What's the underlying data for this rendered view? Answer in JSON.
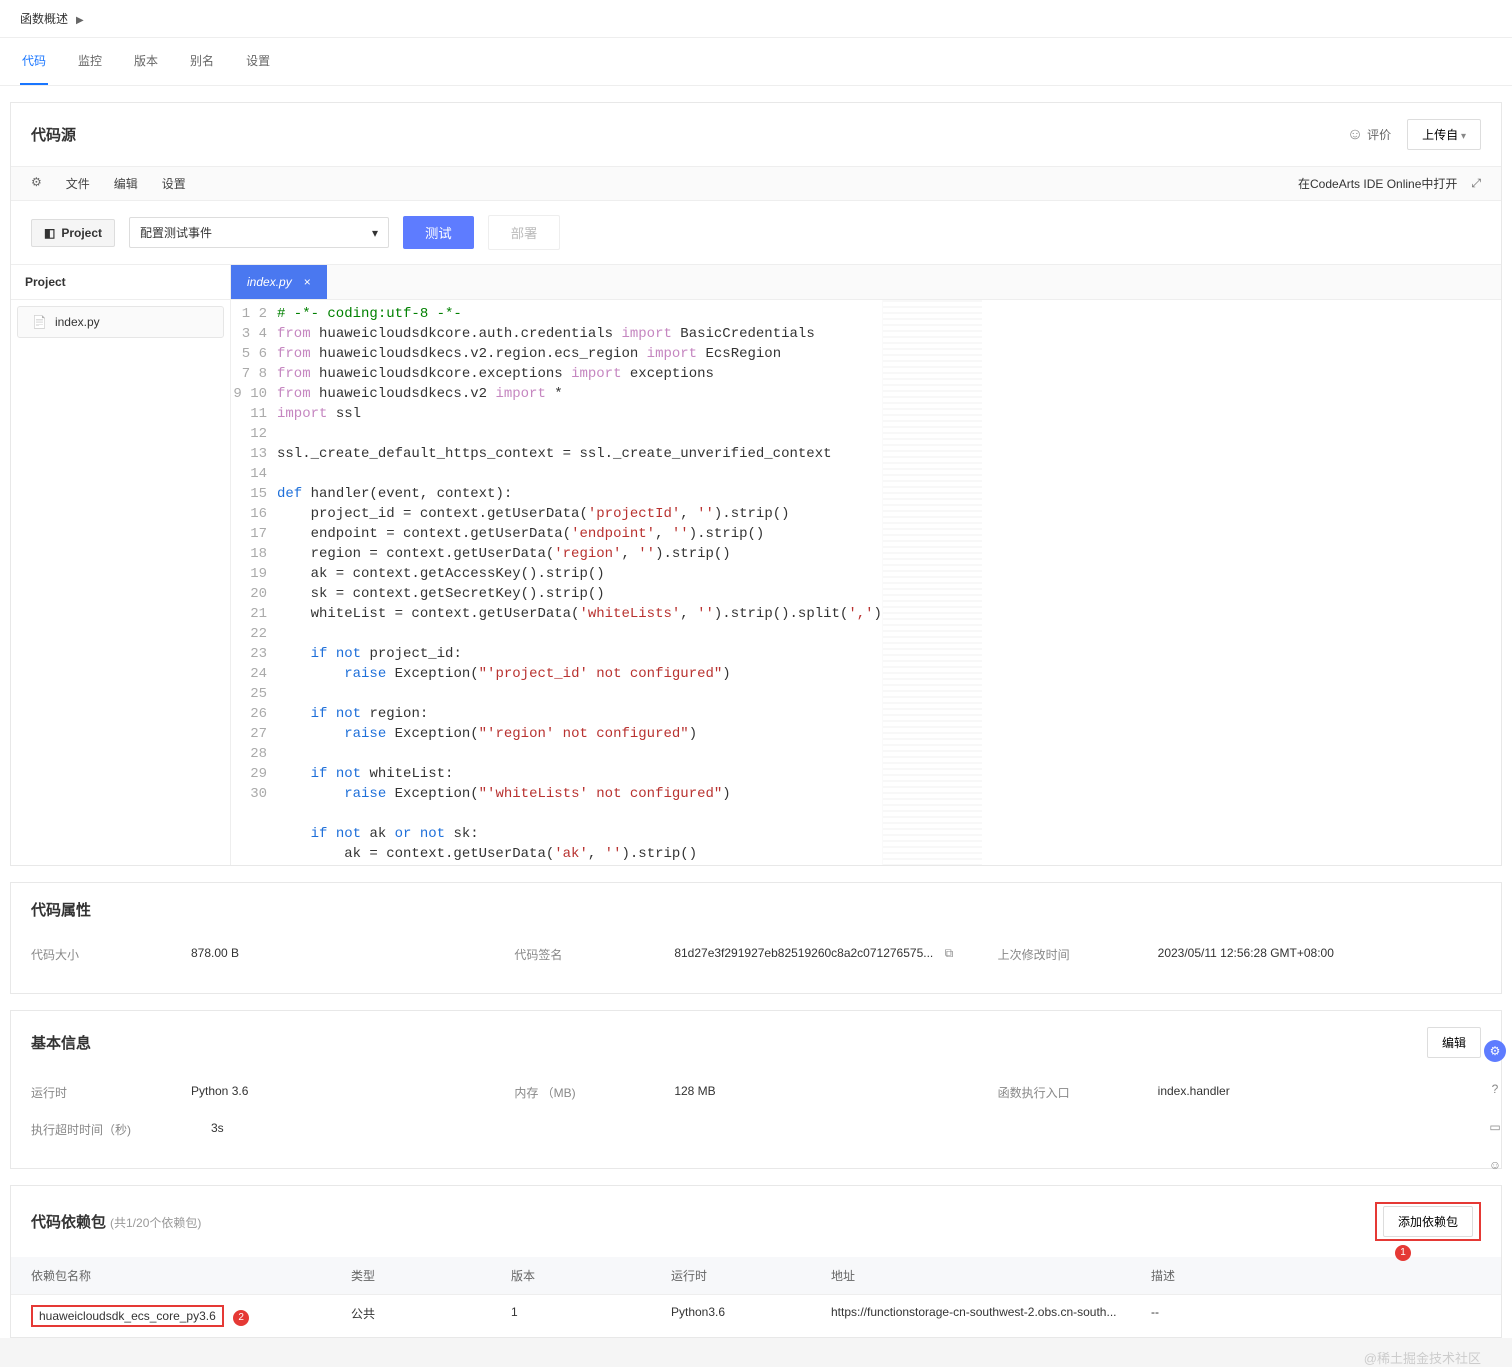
{
  "header": {
    "overview": "函数概述"
  },
  "tabs": {
    "code": "代码",
    "monitor": "监控",
    "version": "版本",
    "alias": "别名",
    "settings": "设置"
  },
  "code_source": {
    "title": "代码源",
    "feedback": "评价",
    "upload_from": "上传自",
    "open_in_ide": "在CodeArts IDE Online中打开",
    "menu_file": "文件",
    "menu_edit": "编辑",
    "menu_settings": "设置",
    "project_btn": "Project",
    "test_event_placeholder": "配置测试事件",
    "test_btn": "测试",
    "deploy_btn": "部署",
    "sidebar_title": "Project",
    "file_name": "index.py",
    "tab_file": "index.py"
  },
  "code_attr": {
    "title": "代码属性",
    "size_label": "代码大小",
    "size_val": "878.00 B",
    "sign_label": "代码签名",
    "sign_val": "81d27e3f291927eb82519260c8a2c071276575...",
    "modified_label": "上次修改时间",
    "modified_val": "2023/05/11 12:56:28 GMT+08:00"
  },
  "basic_info": {
    "title": "基本信息",
    "edit": "编辑",
    "runtime_label": "运行时",
    "runtime_val": "Python 3.6",
    "memory_label": "内存 （MB)",
    "memory_val": "128 MB",
    "entry_label": "函数执行入口",
    "entry_val": "index.handler",
    "timeout_label": "执行超时时间（秒)",
    "timeout_val": "3s"
  },
  "deps": {
    "title": "代码依赖包",
    "count": "(共1/20个依赖包)",
    "add_btn": "添加依赖包",
    "col_name": "依赖包名称",
    "col_type": "类型",
    "col_ver": "版本",
    "col_rt": "运行时",
    "col_addr": "地址",
    "col_desc": "描述",
    "row": {
      "name": "huaweicloudsdk_ecs_core_py3.6",
      "type": "公共",
      "ver": "1",
      "rt": "Python3.6",
      "addr": "https://functionstorage-cn-southwest-2.obs.cn-south...",
      "desc": "--"
    },
    "badge1": "1",
    "badge2": "2"
  },
  "watermark": "@稀土掘金技术社区"
}
